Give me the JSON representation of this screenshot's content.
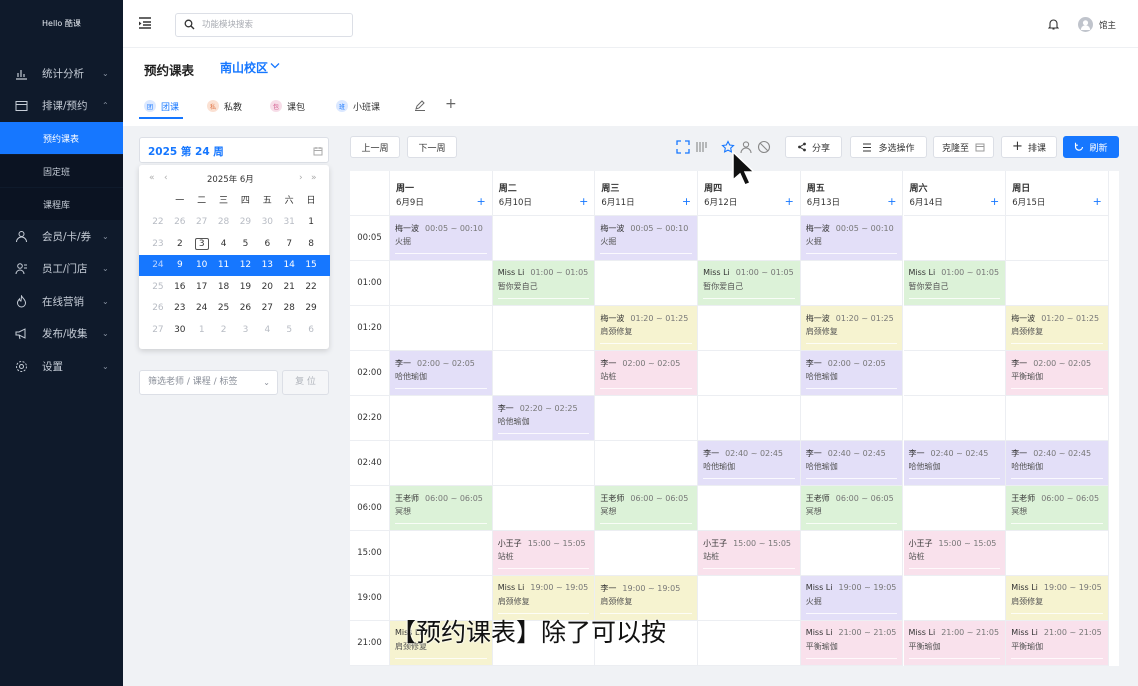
{
  "brand": "Hello 酷课",
  "colors": {
    "accent": "#1677ff",
    "sidebar": "#0f1a2b"
  },
  "sidebar": {
    "items": [
      {
        "label": "统计分析",
        "icon": "chart-icon",
        "arrow": "⌄"
      },
      {
        "label": "排课/预约",
        "icon": "calendar-icon",
        "arrow": "⌃"
      },
      {
        "label": "会员/卡/券",
        "icon": "user-icon",
        "arrow": "⌄"
      },
      {
        "label": "员工/门店",
        "icon": "staff-icon",
        "arrow": "⌄"
      },
      {
        "label": "在线营销",
        "icon": "fire-icon",
        "arrow": "⌄"
      },
      {
        "label": "发布/收集",
        "icon": "megaphone-icon",
        "arrow": "⌄"
      },
      {
        "label": "设置",
        "icon": "gear-icon",
        "arrow": "⌄"
      }
    ],
    "sub_items": [
      {
        "label": "预约课表",
        "active": true
      },
      {
        "label": "固定班"
      },
      {
        "label": "课程库"
      }
    ]
  },
  "topbar": {
    "search_placeholder": "功能模块搜索",
    "user_name": "馆主"
  },
  "page": {
    "title": "预约课表",
    "campus": "南山校区"
  },
  "tabs": [
    {
      "label": "团课",
      "badge": "团",
      "color": "#dbe8ff",
      "fg": "#1677ff"
    },
    {
      "label": "私教",
      "badge": "私",
      "color": "#fbe1d3",
      "fg": "#e0784a"
    },
    {
      "label": "课包",
      "badge": "包",
      "color": "#f7dde8",
      "fg": "#d0568a"
    },
    {
      "label": "小班课",
      "badge": "班",
      "color": "#dbe8ff",
      "fg": "#1677ff"
    }
  ],
  "week_picker": {
    "label": "2025 第 24 周"
  },
  "calendar": {
    "year_month": "2025年  6月",
    "nav_prev_year": "«",
    "nav_prev_month": "‹",
    "nav_next_month": "›",
    "nav_next_year": "»",
    "weekdays": [
      "一",
      "二",
      "三",
      "四",
      "五",
      "六",
      "日"
    ],
    "rows": [
      [
        {
          "d": "26",
          "m": 1
        },
        {
          "d": "27",
          "m": 1
        },
        {
          "d": "28",
          "m": 1
        },
        {
          "d": "29",
          "m": 1
        },
        {
          "d": "30",
          "m": 1
        },
        {
          "d": "31",
          "m": 1
        },
        {
          "d": "1",
          "m": 0
        }
      ],
      [
        {
          "d": "2",
          "m": 0
        },
        {
          "d": "3",
          "m": 0,
          "today": 1
        },
        {
          "d": "4",
          "m": 0
        },
        {
          "d": "5",
          "m": 0
        },
        {
          "d": "6",
          "m": 0
        },
        {
          "d": "7",
          "m": 0
        },
        {
          "d": "8",
          "m": 0
        }
      ],
      [
        {
          "d": "9",
          "m": 0
        },
        {
          "d": "10",
          "m": 0
        },
        {
          "d": "11",
          "m": 0
        },
        {
          "d": "12",
          "m": 0
        },
        {
          "d": "13",
          "m": 0
        },
        {
          "d": "14",
          "m": 0
        },
        {
          "d": "15",
          "m": 0
        }
      ],
      [
        {
          "d": "16",
          "m": 0
        },
        {
          "d": "17",
          "m": 0
        },
        {
          "d": "18",
          "m": 0
        },
        {
          "d": "19",
          "m": 0
        },
        {
          "d": "20",
          "m": 0
        },
        {
          "d": "21",
          "m": 0
        },
        {
          "d": "22",
          "m": 0
        }
      ],
      [
        {
          "d": "23",
          "m": 0
        },
        {
          "d": "24",
          "m": 0
        },
        {
          "d": "25",
          "m": 0
        },
        {
          "d": "26",
          "m": 0
        },
        {
          "d": "27",
          "m": 0
        },
        {
          "d": "28",
          "m": 0
        },
        {
          "d": "29",
          "m": 0
        }
      ],
      [
        {
          "d": "30",
          "m": 0
        },
        {
          "d": "1",
          "m": 1
        },
        {
          "d": "2",
          "m": 1
        },
        {
          "d": "3",
          "m": 1
        },
        {
          "d": "4",
          "m": 1
        },
        {
          "d": "5",
          "m": 1
        },
        {
          "d": "6",
          "m": 1
        }
      ]
    ],
    "week_numbers": [
      "22",
      "23",
      "24",
      "25",
      "26",
      "27"
    ],
    "selected_row": 2
  },
  "filter": {
    "placeholder": "筛选老师 / 课程 / 标签",
    "reset": "复 位"
  },
  "toolbar": {
    "prev_week": "上一周",
    "next_week": "下一周",
    "share": "分享",
    "multi_select": "多选操作",
    "clone_to": "克隆至",
    "add_schedule": "排课",
    "refresh": "刷新"
  },
  "days": [
    {
      "name": "周一",
      "date": "6月9日"
    },
    {
      "name": "周二",
      "date": "6月10日"
    },
    {
      "name": "周三",
      "date": "6月11日"
    },
    {
      "name": "周四",
      "date": "6月12日"
    },
    {
      "name": "周五",
      "date": "6月13日"
    },
    {
      "name": "周六",
      "date": "6月14日"
    },
    {
      "name": "周日",
      "date": "6月15日"
    }
  ],
  "times": [
    "00:05",
    "01:00",
    "01:20",
    "02:00",
    "02:20",
    "02:40",
    "06:00",
    "15:00",
    "19:00",
    "21:00"
  ],
  "events": [
    {
      "row": 0,
      "day": 0,
      "teacher": "梅一波",
      "time": "00:05 ~ 00:10",
      "course": "火掘",
      "color": "purple"
    },
    {
      "row": 0,
      "day": 2,
      "teacher": "梅一波",
      "time": "00:05 ~ 00:10",
      "course": "火掘",
      "color": "purple"
    },
    {
      "row": 0,
      "day": 4,
      "teacher": "梅一波",
      "time": "00:05 ~ 00:10",
      "course": "火掘",
      "color": "purple"
    },
    {
      "row": 1,
      "day": 1,
      "teacher": "Miss Li",
      "time": "01:00 ~ 01:05",
      "course": "暂你爱自己",
      "color": "green"
    },
    {
      "row": 1,
      "day": 3,
      "teacher": "Miss Li",
      "time": "01:00 ~ 01:05",
      "course": "暂你爱自己",
      "color": "green"
    },
    {
      "row": 1,
      "day": 5,
      "teacher": "Miss Li",
      "time": "01:00 ~ 01:05",
      "course": "暂你爱自己",
      "color": "green"
    },
    {
      "row": 2,
      "day": 2,
      "teacher": "梅一波",
      "time": "01:20 ~ 01:25",
      "course": "肩颈修复",
      "color": "yellow"
    },
    {
      "row": 2,
      "day": 4,
      "teacher": "梅一波",
      "time": "01:20 ~ 01:25",
      "course": "肩颈修复",
      "color": "yellow"
    },
    {
      "row": 2,
      "day": 6,
      "teacher": "梅一波",
      "time": "01:20 ~ 01:25",
      "course": "肩颈修复",
      "color": "yellow"
    },
    {
      "row": 3,
      "day": 0,
      "teacher": "李一",
      "time": "02:00 ~ 02:05",
      "course": "哈他瑜伽",
      "color": "purple"
    },
    {
      "row": 3,
      "day": 2,
      "teacher": "李一",
      "time": "02:00 ~ 02:05",
      "course": "站桩",
      "color": "pink"
    },
    {
      "row": 3,
      "day": 4,
      "teacher": "李一",
      "time": "02:00 ~ 02:05",
      "course": "哈他瑜伽",
      "color": "purple"
    },
    {
      "row": 3,
      "day": 6,
      "teacher": "李一",
      "time": "02:00 ~ 02:05",
      "course": "平衡瑜伽",
      "color": "pink"
    },
    {
      "row": 4,
      "day": 1,
      "teacher": "李一",
      "time": "02:20 ~ 02:25",
      "course": "哈他瑜伽",
      "color": "purple"
    },
    {
      "row": 5,
      "day": 3,
      "teacher": "李一",
      "time": "02:40 ~ 02:45",
      "course": "哈他瑜伽",
      "color": "purple"
    },
    {
      "row": 5,
      "day": 4,
      "teacher": "李一",
      "time": "02:40 ~ 02:45",
      "course": "哈他瑜伽",
      "color": "purple"
    },
    {
      "row": 5,
      "day": 5,
      "teacher": "李一",
      "time": "02:40 ~ 02:45",
      "course": "哈他瑜伽",
      "color": "purple"
    },
    {
      "row": 5,
      "day": 6,
      "teacher": "李一",
      "time": "02:40 ~ 02:45",
      "course": "哈他瑜伽",
      "color": "purple"
    },
    {
      "row": 6,
      "day": 0,
      "teacher": "王老师",
      "time": "06:00 ~ 06:05",
      "course": "冥想",
      "color": "green"
    },
    {
      "row": 6,
      "day": 2,
      "teacher": "王老师",
      "time": "06:00 ~ 06:05",
      "course": "冥想",
      "color": "green"
    },
    {
      "row": 6,
      "day": 4,
      "teacher": "王老师",
      "time": "06:00 ~ 06:05",
      "course": "冥想",
      "color": "green"
    },
    {
      "row": 6,
      "day": 6,
      "teacher": "王老师",
      "time": "06:00 ~ 06:05",
      "course": "冥想",
      "color": "green"
    },
    {
      "row": 7,
      "day": 1,
      "teacher": "小王子",
      "time": "15:00 ~ 15:05",
      "course": "站桩",
      "color": "pink"
    },
    {
      "row": 7,
      "day": 3,
      "teacher": "小王子",
      "time": "15:00 ~ 15:05",
      "course": "站桩",
      "color": "pink"
    },
    {
      "row": 7,
      "day": 5,
      "teacher": "小王子",
      "time": "15:00 ~ 15:05",
      "course": "站桩",
      "color": "pink"
    },
    {
      "row": 8,
      "day": 1,
      "teacher": "Miss Li",
      "time": "19:00 ~ 19:05",
      "course": "肩颈修复",
      "color": "yellow"
    },
    {
      "row": 8,
      "day": 2,
      "teacher": "李一",
      "time": "19:00 ~ 19:05",
      "course": "肩颈修复",
      "color": "yellow"
    },
    {
      "row": 8,
      "day": 4,
      "teacher": "Miss Li",
      "time": "19:00 ~ 19:05",
      "course": "火掘",
      "color": "purple"
    },
    {
      "row": 8,
      "day": 6,
      "teacher": "Miss Li",
      "time": "19:00 ~ 19:05",
      "course": "肩颈修复",
      "color": "yellow"
    },
    {
      "row": 9,
      "day": 0,
      "teacher": "Miss Li",
      "time": "",
      "course": "肩颈修复",
      "color": "yellow"
    },
    {
      "row": 9,
      "day": 4,
      "teacher": "Miss Li",
      "time": "21:00 ~ 21:05",
      "course": "平衡瑜伽",
      "color": "pink"
    },
    {
      "row": 9,
      "day": 5,
      "teacher": "Miss Li",
      "time": "21:00 ~ 21:05",
      "course": "平衡瑜伽",
      "color": "pink"
    },
    {
      "row": 9,
      "day": 6,
      "teacher": "Miss Li",
      "time": "21:00 ~ 21:05",
      "course": "平衡瑜伽",
      "color": "pink"
    }
  ],
  "subtitle": "【预约课表】除了可以按"
}
